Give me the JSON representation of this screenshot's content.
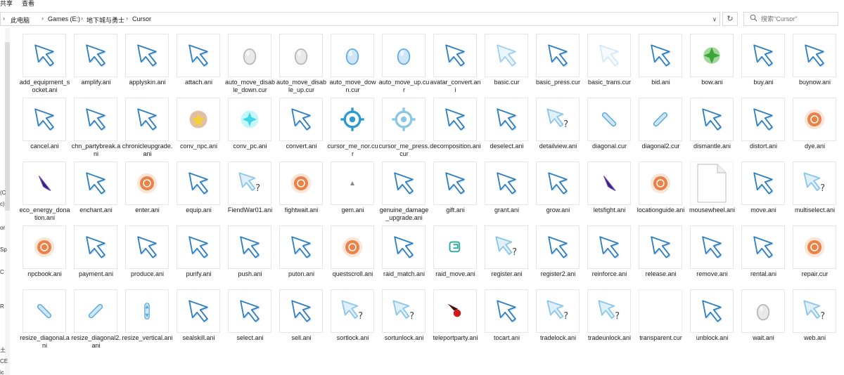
{
  "ribbon": {
    "share": "共享",
    "view": "查看"
  },
  "address": {
    "crumbs": [
      "此电脑",
      "Games (E:)",
      "地下城与勇士",
      "Cursor"
    ]
  },
  "search": {
    "placeholder": "搜索\"Cursor\""
  },
  "navpane": {
    "fragments": [
      "(C",
      "c)",
      "or",
      "Sp",
      "C",
      "R",
      "土",
      "CE",
      "ic"
    ]
  },
  "files": [
    {
      "name": "add_equipment_socket.ani",
      "icon": "cursor-arrow-icon"
    },
    {
      "name": "amplify.ani",
      "icon": "cursor-arrow-icon"
    },
    {
      "name": "applyskin.ani",
      "icon": "cursor-arrow-icon"
    },
    {
      "name": "attach.ani",
      "icon": "cursor-arrow-icon"
    },
    {
      "name": "auto_move_disable_down.cur",
      "icon": "cursor-grey-hand-icon"
    },
    {
      "name": "auto_move_disable_up.cur",
      "icon": "cursor-grey-hand-icon"
    },
    {
      "name": "auto_move_down.cur",
      "icon": "cursor-blue-hand-icon"
    },
    {
      "name": "auto_move_up.cur",
      "icon": "cursor-blue-hand-icon"
    },
    {
      "name": "avatar_convert.ani",
      "icon": "cursor-arrow-icon"
    },
    {
      "name": "basic.cur",
      "icon": "cursor-arrow-light-icon"
    },
    {
      "name": "basic_press.cur",
      "icon": "cursor-arrow-icon"
    },
    {
      "name": "basic_trans.cur",
      "icon": "cursor-arrow-faint-icon"
    },
    {
      "name": "bid.ani",
      "icon": "cursor-arrow-icon"
    },
    {
      "name": "bow.ani",
      "icon": "cursor-green-orb-icon"
    },
    {
      "name": "buy.ani",
      "icon": "cursor-arrow-icon"
    },
    {
      "name": "buynow.ani",
      "icon": "cursor-arrow-icon"
    },
    {
      "name": "cancel.ani",
      "icon": "cursor-arrow-icon"
    },
    {
      "name": "chn_partybreak.ani",
      "icon": "cursor-arrow-icon"
    },
    {
      "name": "chronicleupgrade.ani",
      "icon": "cursor-arrow-icon"
    },
    {
      "name": "conv_npc.ani",
      "icon": "cursor-fire-star-icon"
    },
    {
      "name": "conv_pc.ani",
      "icon": "cursor-cyan-glow-icon"
    },
    {
      "name": "convert.ani",
      "icon": "cursor-arrow-icon"
    },
    {
      "name": "cursor_me_nor.cur",
      "icon": "cursor-target-icon"
    },
    {
      "name": "cursor_me_press.cur",
      "icon": "cursor-target-light-icon"
    },
    {
      "name": "decomposition.ani",
      "icon": "cursor-arrow-icon"
    },
    {
      "name": "deselect.ani",
      "icon": "cursor-arrow-icon"
    },
    {
      "name": "detailview.ani",
      "icon": "cursor-help-icon"
    },
    {
      "name": "diagonal.cur",
      "icon": "cursor-diagonal-resize-icon"
    },
    {
      "name": "diagonal2.cur",
      "icon": "cursor-diagonal2-resize-icon"
    },
    {
      "name": "dismantle.ani",
      "icon": "cursor-arrow-icon"
    },
    {
      "name": "distort.ani",
      "icon": "cursor-arrow-icon"
    },
    {
      "name": "dye.ani",
      "icon": "cursor-orange-orb-icon"
    },
    {
      "name": "eco_energy_donation.ani",
      "icon": "cursor-purple-shard-icon"
    },
    {
      "name": "enchant.ani",
      "icon": "cursor-arrow-icon"
    },
    {
      "name": "enter.ani",
      "icon": "cursor-orange-orb-icon"
    },
    {
      "name": "equip.ani",
      "icon": "cursor-arrow-icon"
    },
    {
      "name": "FiendWar01.ani",
      "icon": "cursor-help-icon"
    },
    {
      "name": "fightwait.ani",
      "icon": "cursor-orange-orb-icon"
    },
    {
      "name": "gem.ani",
      "icon": "cursor-tiny-dot-icon"
    },
    {
      "name": "genuine_damage_upgrade.ani",
      "icon": "cursor-arrow-icon"
    },
    {
      "name": "gift.ani",
      "icon": "cursor-arrow-icon"
    },
    {
      "name": "grant.ani",
      "icon": "cursor-arrow-icon"
    },
    {
      "name": "grow.ani",
      "icon": "cursor-arrow-icon"
    },
    {
      "name": "letsfight.ani",
      "icon": "cursor-purple-shard-icon"
    },
    {
      "name": "locationguide.ani",
      "icon": "cursor-orange-orb-icon"
    },
    {
      "name": "mousewheel.ani",
      "icon": "blank-file-icon"
    },
    {
      "name": "move.ani",
      "icon": "cursor-arrow-icon"
    },
    {
      "name": "multiselect.ani",
      "icon": "cursor-help-icon"
    },
    {
      "name": "npcbook.ani",
      "icon": "cursor-orange-orb-icon"
    },
    {
      "name": "payment.ani",
      "icon": "cursor-arrow-icon"
    },
    {
      "name": "produce.ani",
      "icon": "cursor-arrow-icon"
    },
    {
      "name": "purify.ani",
      "icon": "cursor-arrow-icon"
    },
    {
      "name": "push.ani",
      "icon": "cursor-arrow-icon"
    },
    {
      "name": "puton.ani",
      "icon": "cursor-arrow-icon"
    },
    {
      "name": "questscroll.ani",
      "icon": "cursor-orange-orb-icon"
    },
    {
      "name": "raid_match.ani",
      "icon": "cursor-arrow-icon"
    },
    {
      "name": "raid_move.ani",
      "icon": "cursor-teal-flag-icon"
    },
    {
      "name": "register.ani",
      "icon": "cursor-help-icon"
    },
    {
      "name": "register2.ani",
      "icon": "cursor-arrow-icon"
    },
    {
      "name": "reinforce.ani",
      "icon": "cursor-arrow-icon"
    },
    {
      "name": "release.ani",
      "icon": "cursor-arrow-icon"
    },
    {
      "name": "remove.ani",
      "icon": "cursor-arrow-icon"
    },
    {
      "name": "rental.ani",
      "icon": "cursor-arrow-icon"
    },
    {
      "name": "repair.cur",
      "icon": "cursor-orange-orb-icon"
    },
    {
      "name": "resize_diagonal.ani",
      "icon": "cursor-diagonal-resize-icon"
    },
    {
      "name": "resize_diagonal2.ani",
      "icon": "cursor-diagonal2-resize-icon"
    },
    {
      "name": "resize_vertical.ani",
      "icon": "cursor-vertical-resize-icon"
    },
    {
      "name": "sealskill.ani",
      "icon": "cursor-arrow-icon"
    },
    {
      "name": "select.ani",
      "icon": "cursor-arrow-icon"
    },
    {
      "name": "sell.ani",
      "icon": "cursor-arrow-icon"
    },
    {
      "name": "sortlock.ani",
      "icon": "cursor-help-icon"
    },
    {
      "name": "sortunlock.ani",
      "icon": "cursor-help-icon"
    },
    {
      "name": "teleportparty.ani",
      "icon": "cursor-red-orb-icon"
    },
    {
      "name": "tocart.ani",
      "icon": "cursor-arrow-icon"
    },
    {
      "name": "tradelock.ani",
      "icon": "cursor-help-icon"
    },
    {
      "name": "tradeunlock.ani",
      "icon": "cursor-help-icon"
    },
    {
      "name": "transparent.cur",
      "icon": "cursor-empty-icon"
    },
    {
      "name": "unblock.ani",
      "icon": "cursor-arrow-icon"
    },
    {
      "name": "wait.ani",
      "icon": "cursor-grey-hand-icon"
    },
    {
      "name": "web.ani",
      "icon": "cursor-help-icon"
    }
  ],
  "colors": {
    "cursor_blue": "#2f7fc1",
    "cursor_light": "#9fd0f2",
    "orange_orb": "#e8824a",
    "green_orb": "#3da53a",
    "purple_shard": "#3a1f7a",
    "target_teal": "#2b9bd0",
    "red_orb": "#d01818",
    "teal_flag": "#2aa8a0"
  }
}
